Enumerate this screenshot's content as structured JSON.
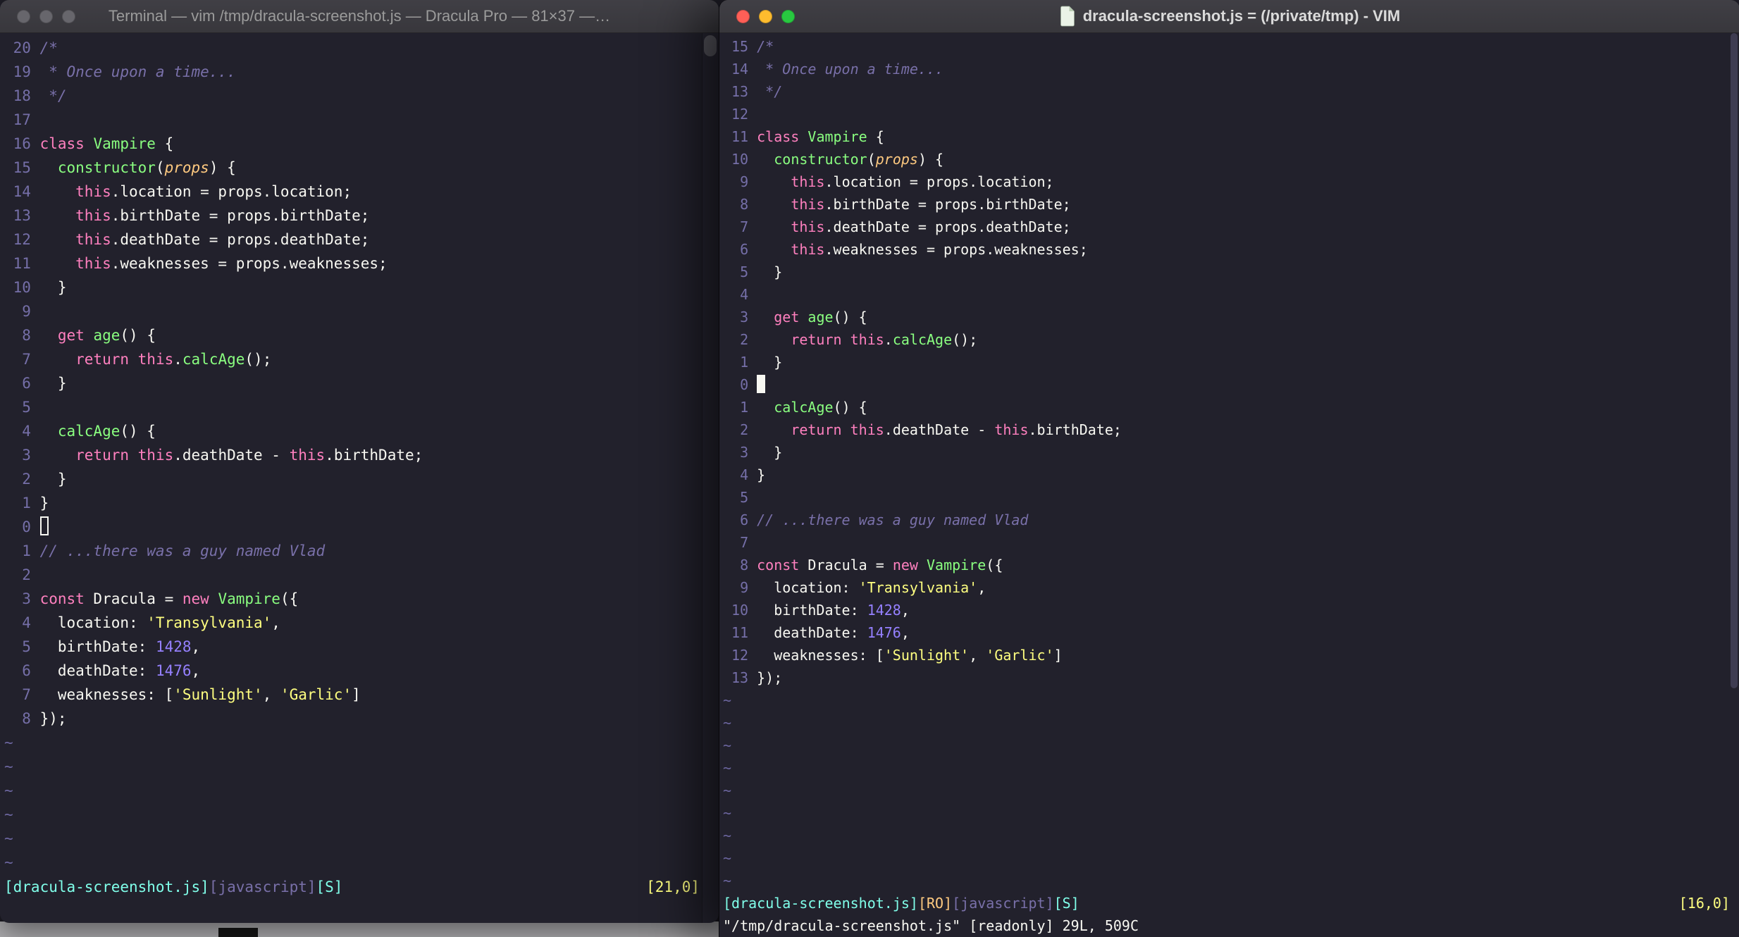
{
  "palette": {
    "bg": "#22212C",
    "fg": "#F8F8F2",
    "comment": "#7970A9",
    "cyan": "#80FFEA",
    "green": "#8AFF80",
    "orange": "#FFCA80",
    "pink": "#FF80BF",
    "purple": "#9580FF",
    "yellow": "#FFFF80",
    "linenr": "#756FA8",
    "tilde": "#6C66A0",
    "titlebartop": "#403F45",
    "titlebarbottom": "#38373C",
    "titlebarborder": "#252428",
    "titleinactive": "#9B9B9B",
    "titleactive": "#DBDBDB",
    "btninactive": "#67666C",
    "close": "#FF5F57",
    "minimize": "#FEBC2E",
    "zoom": "#28C840",
    "scrolltrack": "#272632",
    "scrollthumb": "#57565E",
    "strip": "#AFAEB1",
    "striprect": "#161616"
  },
  "tilde_char": "~",
  "left_window": {
    "title": "Terminal — vim /tmp/dracula-screenshot.js — Dracula Pro — 81×37 —…",
    "cursor_line_index": 20,
    "cursor_style": "hollow",
    "tilde_count": 6,
    "line_numbers": [
      "20",
      "19",
      "18",
      "17",
      "16",
      "15",
      "14",
      "13",
      "12",
      "11",
      "10",
      "9",
      "8",
      "7",
      "6",
      "5",
      "4",
      "3",
      "2",
      "1",
      "0",
      "1",
      "2",
      "3",
      "4",
      "5",
      "6",
      "7",
      "8"
    ],
    "statusline": {
      "left": [
        {
          "text": "[dracula-screenshot.js]",
          "color": "cyan"
        },
        {
          "text": "[javascript]",
          "color": "comment"
        },
        {
          "text": "[S]",
          "color": "cyan"
        }
      ],
      "right": [
        {
          "text": "[21,0]",
          "color": "yellow"
        }
      ]
    },
    "command_line": ""
  },
  "right_window": {
    "title": "dracula-screenshot.js = (/private/tmp) - VIM",
    "cursor_line_index": 15,
    "cursor_style": "block",
    "tilde_count": 9,
    "line_numbers": [
      "15",
      "14",
      "13",
      "12",
      "11",
      "10",
      "9",
      "8",
      "7",
      "6",
      "5",
      "4",
      "3",
      "2",
      "1",
      "0",
      "1",
      "2",
      "3",
      "4",
      "5",
      "6",
      "7",
      "8",
      "9",
      "10",
      "11",
      "12",
      "13"
    ],
    "statusline": {
      "left": [
        {
          "text": "[dracula-screenshot.js]",
          "color": "cyan"
        },
        {
          "text": "[RO]",
          "color": "orange"
        },
        {
          "text": "[javascript]",
          "color": "comment"
        },
        {
          "text": "[S]",
          "color": "cyan"
        }
      ],
      "right": [
        {
          "text": "[16,0]",
          "color": "yellow"
        }
      ]
    },
    "command_line": "\"/tmp/dracula-screenshot.js\" [readonly] 29L, 509C"
  },
  "code_lines": [
    {
      "tokens": [
        [
          "c",
          "/*"
        ]
      ]
    },
    {
      "tokens": [
        [
          "c",
          " * Once upon a time..."
        ]
      ]
    },
    {
      "tokens": [
        [
          "c",
          " */"
        ]
      ]
    },
    {
      "tokens": []
    },
    {
      "tokens": [
        [
          "k",
          "class"
        ],
        [
          "w",
          " "
        ],
        [
          "f",
          "Vampire"
        ],
        [
          "w",
          " {"
        ]
      ]
    },
    {
      "tokens": [
        [
          "w",
          "  "
        ],
        [
          "f",
          "constructor"
        ],
        [
          "w",
          "("
        ],
        [
          "o",
          "props"
        ],
        [
          "w",
          ") {"
        ]
      ]
    },
    {
      "tokens": [
        [
          "w",
          "    "
        ],
        [
          "k",
          "this"
        ],
        [
          "w",
          ".location = props.location;"
        ]
      ]
    },
    {
      "tokens": [
        [
          "w",
          "    "
        ],
        [
          "k",
          "this"
        ],
        [
          "w",
          ".birthDate = props.birthDate;"
        ]
      ]
    },
    {
      "tokens": [
        [
          "w",
          "    "
        ],
        [
          "k",
          "this"
        ],
        [
          "w",
          ".deathDate = props.deathDate;"
        ]
      ]
    },
    {
      "tokens": [
        [
          "w",
          "    "
        ],
        [
          "k",
          "this"
        ],
        [
          "w",
          ".weaknesses = props.weaknesses;"
        ]
      ]
    },
    {
      "tokens": [
        [
          "w",
          "  }"
        ]
      ]
    },
    {
      "tokens": []
    },
    {
      "tokens": [
        [
          "w",
          "  "
        ],
        [
          "k",
          "get"
        ],
        [
          "w",
          " "
        ],
        [
          "f",
          "age"
        ],
        [
          "w",
          "() {"
        ]
      ]
    },
    {
      "tokens": [
        [
          "w",
          "    "
        ],
        [
          "k",
          "return"
        ],
        [
          "w",
          " "
        ],
        [
          "k",
          "this"
        ],
        [
          "w",
          "."
        ],
        [
          "f",
          "calcAge"
        ],
        [
          "w",
          "();"
        ]
      ]
    },
    {
      "tokens": [
        [
          "w",
          "  }"
        ]
      ]
    },
    {
      "tokens": []
    },
    {
      "tokens": [
        [
          "w",
          "  "
        ],
        [
          "f",
          "calcAge"
        ],
        [
          "w",
          "() {"
        ]
      ]
    },
    {
      "tokens": [
        [
          "w",
          "    "
        ],
        [
          "k",
          "return"
        ],
        [
          "w",
          " "
        ],
        [
          "k",
          "this"
        ],
        [
          "w",
          ".deathDate - "
        ],
        [
          "k",
          "this"
        ],
        [
          "w",
          ".birthDate;"
        ]
      ]
    },
    {
      "tokens": [
        [
          "w",
          "  }"
        ]
      ]
    },
    {
      "tokens": [
        [
          "w",
          "}"
        ]
      ]
    },
    {
      "tokens": []
    },
    {
      "tokens": [
        [
          "c",
          "// ...there was a guy named Vlad"
        ]
      ]
    },
    {
      "tokens": []
    },
    {
      "tokens": [
        [
          "k",
          "const"
        ],
        [
          "w",
          " Dracula = "
        ],
        [
          "k",
          "new"
        ],
        [
          "w",
          " "
        ],
        [
          "f",
          "Vampire"
        ],
        [
          "w",
          "({"
        ]
      ]
    },
    {
      "tokens": [
        [
          "w",
          "  location: "
        ],
        [
          "s",
          "'Transylvania'"
        ],
        [
          "w",
          ","
        ]
      ]
    },
    {
      "tokens": [
        [
          "w",
          "  birthDate: "
        ],
        [
          "n",
          "1428"
        ],
        [
          "w",
          ","
        ]
      ]
    },
    {
      "tokens": [
        [
          "w",
          "  deathDate: "
        ],
        [
          "n",
          "1476"
        ],
        [
          "w",
          ","
        ]
      ]
    },
    {
      "tokens": [
        [
          "w",
          "  weaknesses: ["
        ],
        [
          "s",
          "'Sunlight'"
        ],
        [
          "w",
          ", "
        ],
        [
          "s",
          "'Garlic'"
        ],
        [
          "w",
          "]"
        ]
      ]
    },
    {
      "tokens": [
        [
          "w",
          "});"
        ]
      ]
    }
  ]
}
